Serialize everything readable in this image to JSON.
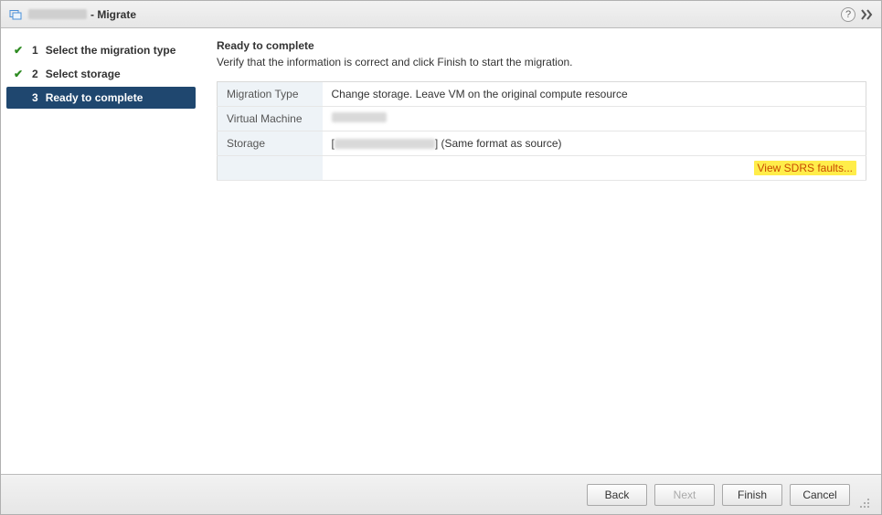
{
  "titlebar": {
    "suffix": "- Migrate"
  },
  "sidebar": {
    "steps": [
      {
        "num": "1",
        "label": "Select the migration type",
        "done": true
      },
      {
        "num": "2",
        "label": "Select storage",
        "done": true
      },
      {
        "num": "3",
        "label": "Ready to complete",
        "active": true
      }
    ]
  },
  "main": {
    "heading": "Ready to complete",
    "subtitle": "Verify that the information is correct and click Finish to start the migration.",
    "rows": {
      "migration_type_key": "Migration Type",
      "migration_type_val": "Change storage. Leave VM on the original compute resource",
      "virtual_machine_key": "Virtual Machine",
      "storage_key": "Storage",
      "storage_suffix": "] (Same format as source)"
    },
    "sdrs_link": "View SDRS faults..."
  },
  "footer": {
    "back": "Back",
    "next": "Next",
    "finish": "Finish",
    "cancel": "Cancel"
  }
}
